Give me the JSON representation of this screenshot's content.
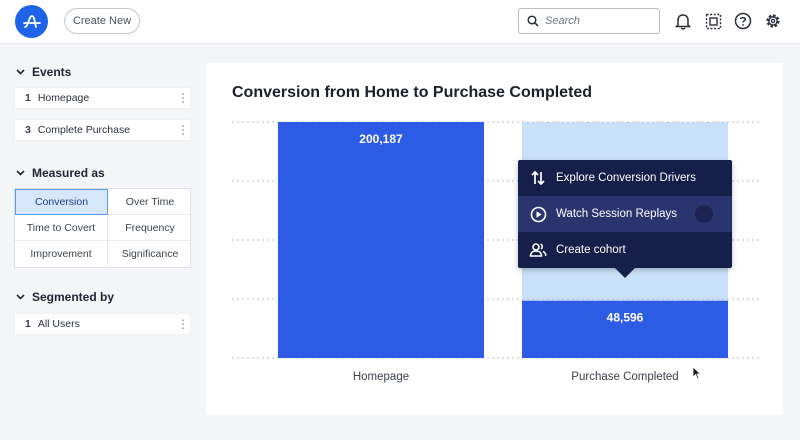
{
  "header": {
    "create_label": "Create New",
    "search_placeholder": "Search",
    "icons": [
      "logo-icon",
      "bell-icon",
      "grid-select-icon",
      "help-icon",
      "gear-icon"
    ]
  },
  "sidebar": {
    "events_title": "Events",
    "events": [
      {
        "num": "1",
        "label": "Homepage"
      },
      {
        "num": "3",
        "label": "Complete Purchase"
      }
    ],
    "measured_title": "Measured as",
    "measures": [
      "Conversion",
      "Over Time",
      "Time to Covert",
      "Frequency",
      "Improvement",
      "Significance"
    ],
    "active_measure": "Conversion",
    "segmented_title": "Segmented by",
    "segments": [
      {
        "num": "1",
        "label": "All Users"
      }
    ]
  },
  "colors": {
    "accent": "#2c5be6",
    "bar_remaining": "#c9e1f8",
    "menu_bg": "#141f4a"
  },
  "chart_data": {
    "type": "bar",
    "title": "Conversion from Home to Purchase Completed",
    "categories": [
      "Homepage",
      "Purchase Completed"
    ],
    "values": [
      200187,
      48596
    ],
    "value_labels": [
      "200,187",
      "48,596"
    ],
    "ylim": [
      0,
      200187
    ],
    "grid": true,
    "xlabel": "",
    "ylabel": ""
  },
  "menu": {
    "items": [
      {
        "label": "Explore Conversion Drivers",
        "icon": "sort-arrows-icon"
      },
      {
        "label": "Watch Session Replays",
        "icon": "play-circle-icon"
      },
      {
        "label": "Create cohort",
        "icon": "users-icon"
      }
    ]
  }
}
